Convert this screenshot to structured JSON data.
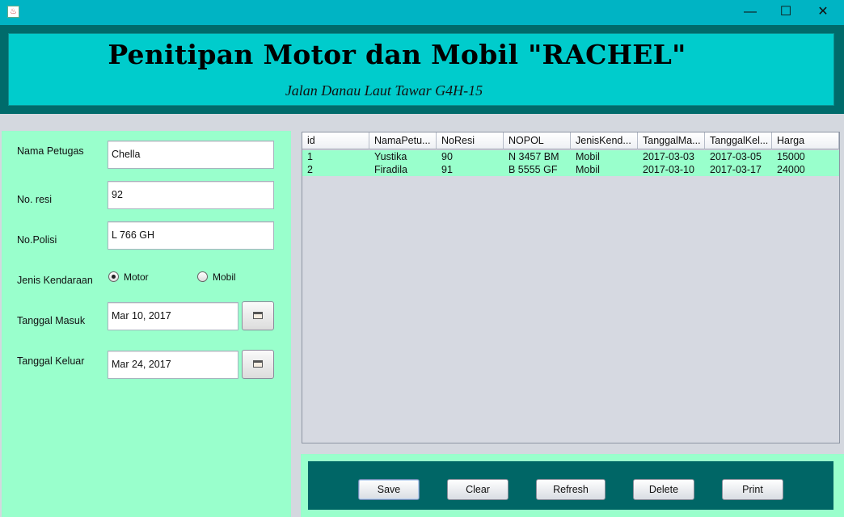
{
  "window": {
    "icon": "java-cup-icon",
    "controls": {
      "minimize": "—",
      "maximize": "☐",
      "close": "✕"
    }
  },
  "header": {
    "title": "Penitipan Motor dan Mobil \"RACHEL\"",
    "subtitle": "Jalan Danau Laut Tawar G4H-15"
  },
  "form": {
    "nama_petugas": {
      "label": "Nama Petugas",
      "value": "Chella"
    },
    "no_resi": {
      "label": "No. resi",
      "value": "92"
    },
    "no_polisi": {
      "label": "No.Polisi",
      "value": "L 766 GH"
    },
    "jenis_kendaraan": {
      "label": "Jenis Kendaraan",
      "options": [
        {
          "label": "Motor",
          "selected": true
        },
        {
          "label": "Mobil",
          "selected": false
        }
      ]
    },
    "tanggal_masuk": {
      "label": "Tanggal Masuk",
      "value": "Mar 10, 2017"
    },
    "tanggal_keluar": {
      "label": "Tanggal Keluar",
      "value": "Mar 24, 2017"
    }
  },
  "table": {
    "columns": [
      "id",
      "NamaPetu...",
      "NoResi",
      "NOPOL",
      "JenisKend...",
      "TanggalMa...",
      "TanggalKel...",
      "Harga"
    ],
    "rows": [
      [
        "1",
        "Yustika",
        "90",
        "N 3457 BM",
        "Mobil",
        "2017-03-03",
        "2017-03-05",
        "15000"
      ],
      [
        "2",
        "Firadila",
        "91",
        "B 5555 GF",
        "Mobil",
        "2017-03-10",
        "2017-03-17",
        "24000"
      ]
    ]
  },
  "buttons": {
    "save": "Save",
    "clear": "Clear",
    "refresh": "Refresh",
    "delete": "Delete",
    "print": "Print"
  },
  "colors": {
    "header_bg": "#00cccc",
    "header_border": "#006b6b",
    "panel_bg": "#99ffcc",
    "button_bar": "#006666"
  }
}
